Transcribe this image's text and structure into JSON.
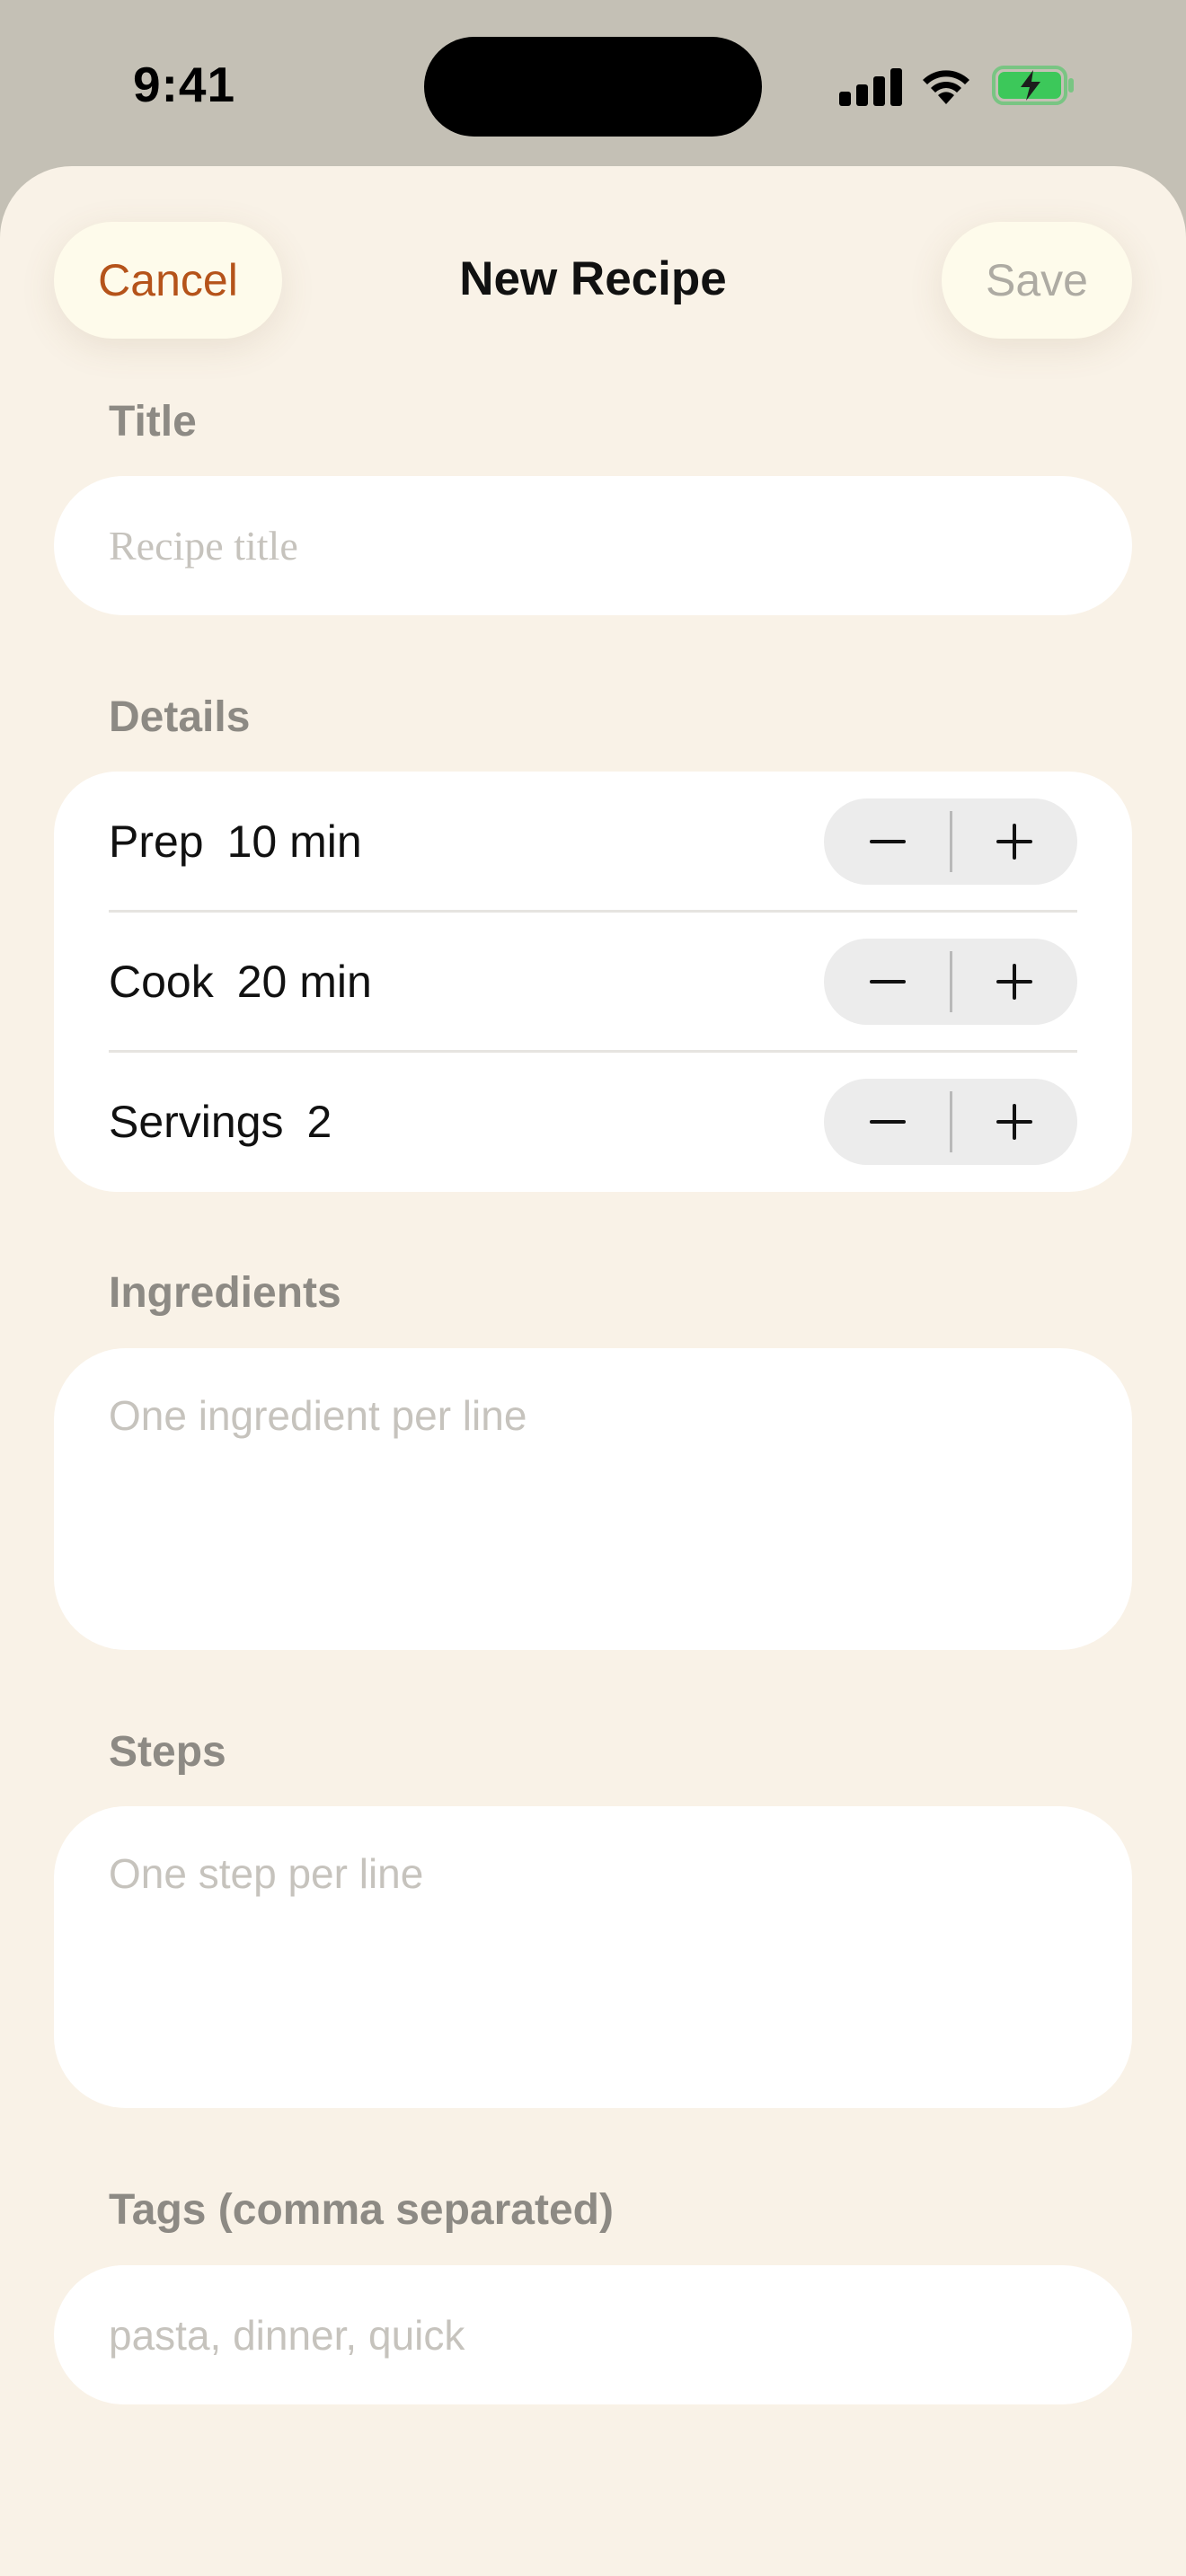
{
  "status_bar": {
    "time": "9:41"
  },
  "nav": {
    "cancel_label": "Cancel",
    "title": "New Recipe",
    "save_label": "Save"
  },
  "form": {
    "title_label": "Title",
    "title_placeholder": "Recipe title",
    "details_label": "Details",
    "details": [
      {
        "name": "Prep",
        "value": "10 min"
      },
      {
        "name": "Cook",
        "value": "20 min"
      },
      {
        "name": "Servings",
        "value": "2"
      }
    ],
    "ingredients_label": "Ingredients",
    "ingredients_placeholder": "One ingredient per line",
    "steps_label": "Steps",
    "steps_placeholder": "One step per line",
    "tags_label": "Tags (comma separated)",
    "tags_placeholder": "pasta, dinner, quick"
  },
  "colors": {
    "accent": "#b5531a",
    "sheet_background": "#f9f2e7",
    "backdrop": "#c4c0b5",
    "battery": "#3cc85a"
  },
  "icons": [
    "cellular-signal-icon",
    "wifi-icon",
    "battery-charging-icon",
    "minus-icon",
    "plus-icon"
  ]
}
